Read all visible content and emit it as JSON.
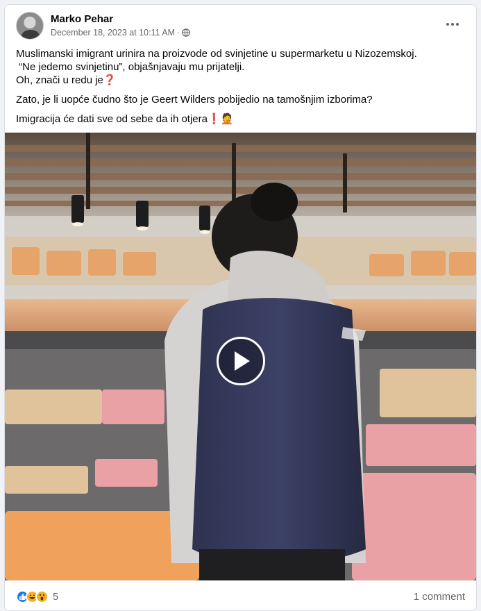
{
  "post": {
    "author": "Marko Pehar",
    "timestamp": "December 18, 2023 at 10:11 AM",
    "separator": "·",
    "privacy_icon": "globe-icon",
    "more_icon": "more-horizontal-icon"
  },
  "text": {
    "line1": "Muslimanski imigrant urinira na proizvode od svinjetine u supermarketu u Nizozemskoj.",
    "line2": "“Ne jedemo svinjetinu”, objašnjavaju mu prijatelji.",
    "line3": "Oh, znači u redu je",
    "line3_emoji": "❓",
    "line4": "Zato, je li uopće čudno što je Geert Wilders pobijedio na tamošnjim izborima?",
    "line5": "Imigracija će dati sve od sebe da ih otjera",
    "line5_emoji1": "❗",
    "line5_emoji2": "🤦"
  },
  "video": {
    "play_icon": "play-icon",
    "scene": "supermarket-meat-counter"
  },
  "footer": {
    "reaction_icons": [
      "like-icon",
      "haha-icon",
      "wow-icon"
    ],
    "reaction_count": "5",
    "comments": "1 comment"
  },
  "colors": {
    "like": "#1877f2",
    "haha": "#f7b125",
    "muted_text": "#65676b"
  }
}
